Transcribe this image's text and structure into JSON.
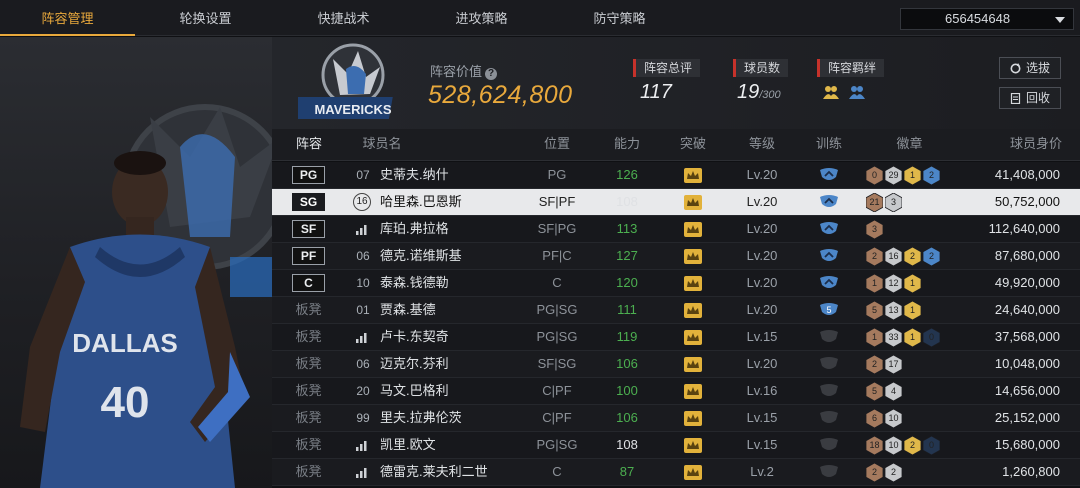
{
  "nav": {
    "tabs": [
      "阵容管理",
      "轮换设置",
      "快捷战术",
      "进攻策略",
      "防守策略"
    ],
    "active_tab": 0,
    "account_id": "656454648"
  },
  "team": {
    "value_label": "阵容价值",
    "value": "528,624,800",
    "rating_label": "阵容总评",
    "rating": "117",
    "count_label": "球员数",
    "count": "19",
    "count_max": "/300",
    "bond_label": "阵容羁绊",
    "logo_text": "MAVERICKS"
  },
  "buttons": {
    "trade": "选拔",
    "recycle": "回收"
  },
  "player_art": {
    "jersey_team": "DALLAS",
    "jersey_number": "40"
  },
  "table": {
    "headers": [
      "阵容",
      "球员名",
      "位置",
      "能力",
      "突破",
      "等级",
      "训练",
      "徽章",
      "球员身价"
    ],
    "rows": [
      {
        "slot": "PG",
        "num": "07",
        "name": "史蒂夫.纳什",
        "position": "PG",
        "ability": "126",
        "level": "Lv.20",
        "train": "up",
        "badges": [
          "0",
          "29",
          "1",
          "2"
        ],
        "price": "41,408,000"
      },
      {
        "slot": "SG",
        "num": "16",
        "name": "哈里森.巴恩斯",
        "position": "SF|PF",
        "ability": "108",
        "level": "Lv.20",
        "train": "up",
        "badges": [
          "21",
          "3"
        ],
        "price": "50,752,000",
        "selected": true
      },
      {
        "slot": "SF",
        "num": "bars",
        "name": "库珀.弗拉格",
        "position": "SF|PG",
        "ability": "113",
        "level": "Lv.20",
        "train": "up",
        "badges": [
          "3"
        ],
        "price": "112,640,000"
      },
      {
        "slot": "PF",
        "num": "06",
        "name": "德克.诺维斯基",
        "position": "PF|C",
        "ability": "127",
        "level": "Lv.20",
        "train": "up",
        "badges": [
          "2",
          "16",
          "2",
          "2"
        ],
        "price": "87,680,000"
      },
      {
        "slot": "C",
        "num": "10",
        "name": "泰森.钱德勒",
        "position": "C",
        "ability": "120",
        "level": "Lv.20",
        "train": "up",
        "badges": [
          "1",
          "12",
          "1"
        ],
        "price": "49,920,000"
      },
      {
        "slot": "板凳",
        "num": "01",
        "name": "贾森.基德",
        "position": "PG|SG",
        "ability": "111",
        "level": "Lv.20",
        "train": "5",
        "badges": [
          "5",
          "13",
          "1"
        ],
        "price": "24,640,000"
      },
      {
        "slot": "板凳",
        "num": "bars",
        "name": "卢卡.东契奇",
        "position": "PG|SG",
        "ability": "119",
        "level": "Lv.15",
        "train": "none",
        "badges": [
          "1",
          "33",
          "1",
          "0"
        ],
        "price": "37,568,000"
      },
      {
        "slot": "板凳",
        "num": "06",
        "name": "迈克尔.芬利",
        "position": "SF|SG",
        "ability": "106",
        "level": "Lv.20",
        "train": "none",
        "badges": [
          "2",
          "17"
        ],
        "price": "10,048,000"
      },
      {
        "slot": "板凳",
        "num": "20",
        "name": "马文.巴格利",
        "position": "C|PF",
        "ability": "100",
        "level": "Lv.16",
        "train": "none",
        "badges": [
          "5",
          "4"
        ],
        "price": "14,656,000"
      },
      {
        "slot": "板凳",
        "num": "99",
        "name": "里夫.拉弗伦茨",
        "position": "C|PF",
        "ability": "106",
        "level": "Lv.15",
        "train": "none",
        "badges": [
          "6",
          "10"
        ],
        "price": "25,152,000"
      },
      {
        "slot": "板凳",
        "num": "bars",
        "name": "凯里.欧文",
        "position": "PG|SG",
        "ability": "108",
        "level": "Lv.15",
        "train": "none",
        "badges": [
          "18",
          "10",
          "2",
          "0"
        ],
        "price": "15,680,000"
      },
      {
        "slot": "板凳",
        "num": "bars",
        "name": "德雷克.莱夫利二世",
        "position": "C",
        "ability": "87",
        "level": "Lv.2",
        "train": "none",
        "badges": [
          "2",
          "2"
        ],
        "price": "1,260,800"
      }
    ]
  },
  "colors": {
    "accent": "#e9a93c",
    "power_green": "#4caf50",
    "bronze": "#a57a5e",
    "silver": "#c7c9cc",
    "gold": "#e0b84a",
    "blue": "#4c86c8",
    "red_marker": "#c6322b"
  }
}
